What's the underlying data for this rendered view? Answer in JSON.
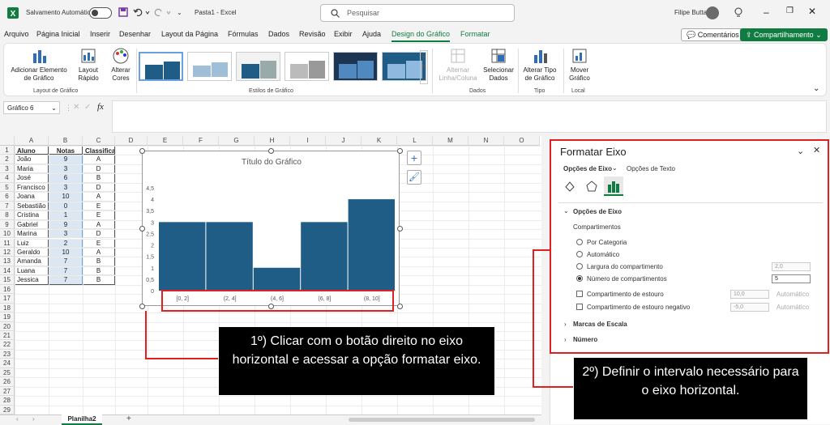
{
  "titlebar": {
    "autosave_label": "Salvamento Automático",
    "doc_title": "Pasta1  -  Excel",
    "search_placeholder": "Pesquisar",
    "user_name": "Filipe Butta"
  },
  "menu": {
    "items": [
      "Arquivo",
      "Página Inicial",
      "Inserir",
      "Desenhar",
      "Layout da Página",
      "Fórmulas",
      "Dados",
      "Revisão",
      "Exibir",
      "Ajuda",
      "Design do Gráfico",
      "Formatar"
    ],
    "active": "Design do Gráfico",
    "comments_label": "Comentários",
    "share_label": "Compartilhamento"
  },
  "ribbon": {
    "add_element": "Adicionar Elemento de Gráfico",
    "quick_layout": "Layout Rápido",
    "change_colors": "Alterar Cores",
    "group_layouts": "Layout de Gráfico",
    "group_styles": "Estilos de Gráfico",
    "switch_row_col": "Alternar Linha/Coluna",
    "select_data": "Selecionar Dados",
    "group_data": "Dados",
    "change_type": "Alterar Tipo de Gráfico",
    "group_type": "Tipo",
    "move_chart": "Mover Gráfico",
    "group_location": "Local"
  },
  "formula_bar": {
    "name_box": "Gráfico 6",
    "fx": "fx"
  },
  "columns": [
    "A",
    "B",
    "C",
    "D",
    "E",
    "F",
    "G",
    "H",
    "I",
    "J",
    "K",
    "L",
    "M",
    "N",
    "O"
  ],
  "rows": [
    "1",
    "2",
    "3",
    "4",
    "5",
    "6",
    "7",
    "8",
    "9",
    "10",
    "11",
    "12",
    "13",
    "14",
    "15",
    "16",
    "17",
    "18",
    "19",
    "20",
    "21",
    "22",
    "23",
    "24",
    "25",
    "26",
    "27",
    "28",
    "29"
  ],
  "table": {
    "headers": [
      "Aluno",
      "Notas",
      "Classificação"
    ],
    "rows": [
      [
        "João",
        "9",
        "A"
      ],
      [
        "Maria",
        "3",
        "D"
      ],
      [
        "José",
        "6",
        "B"
      ],
      [
        "Francisco",
        "3",
        "D"
      ],
      [
        "Joana",
        "10",
        "A"
      ],
      [
        "Sebastião",
        "0",
        "E"
      ],
      [
        "Cristina",
        "1",
        "E"
      ],
      [
        "Gabriel",
        "9",
        "A"
      ],
      [
        "Marina",
        "3",
        "D"
      ],
      [
        "Luiz",
        "2",
        "E"
      ],
      [
        "Geraldo",
        "10",
        "A"
      ],
      [
        "Amanda",
        "7",
        "B"
      ],
      [
        "Luana",
        "7",
        "B"
      ],
      [
        "Jessica",
        "7",
        "B"
      ]
    ]
  },
  "chart_data": {
    "type": "bar",
    "title": "Título do Gráfico",
    "categories": [
      "[0, 2]",
      "(2, 4]",
      "(4, 6]",
      "(6, 8]",
      "(8, 10]"
    ],
    "values": [
      3,
      3,
      1,
      3,
      4
    ],
    "y_ticks": [
      "0",
      "0,5",
      "1",
      "1,5",
      "2",
      "2,5",
      "3",
      "3,5",
      "4",
      "4,5"
    ],
    "ylim": [
      0,
      4.5
    ],
    "bar_color": "#1f5d86"
  },
  "sheet_tabs": {
    "active": "Planilha2",
    "add": "+"
  },
  "pane": {
    "title": "Formatar Eixo",
    "tab_axis": "Opções de Eixo",
    "tab_text": "Opções de Texto",
    "section_axis": "Opções de Eixo",
    "bins_label": "Compartimentos",
    "opt_category": "Por Categoria",
    "opt_auto": "Automático",
    "opt_width": "Largura do compartimento",
    "opt_count": "Número de compartimentos",
    "width_value": "2,0",
    "count_value": "5",
    "overflow_label": "Compartimento de estouro",
    "overflow_value": "10,0",
    "underflow_label": "Compartimento de estouro negativo",
    "underflow_value": "-5,0",
    "auto_label": "Automático",
    "tick_marks": "Marcas de Escala",
    "number": "Número"
  },
  "annotations": {
    "step1": "1º) Clicar com o botão direito no eixo horizontal e acessar a opção formatar eixo.",
    "step2": "2º) Definir o intervalo necessário para o eixo horizontal."
  },
  "colors": {
    "accent": "#107c41",
    "bar": "#1f5d86",
    "annotation": "#e02020"
  }
}
